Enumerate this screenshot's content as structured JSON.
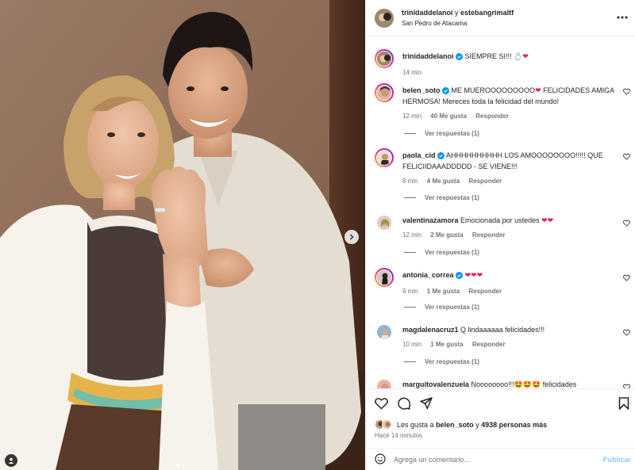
{
  "post": {
    "header": {
      "user1": "trinidaddelanoi",
      "conjunction": "y",
      "user2": "estebangrimaltf",
      "location": "San Pedro de Atacama",
      "more_icon": "more-horizontal-icon"
    },
    "caption": {
      "user": "trinidaddelanoi",
      "text": "SIEMPRE SI!!! 💍",
      "time": "14 min"
    },
    "comments": [
      {
        "user": "belen_soto",
        "verified": true,
        "text": "ME MUEROOOOOOOOO",
        "text_after": " FELICIDADES AMIGA HERMOSA! Mereces toda la felicidad del mundo!",
        "hearts": "❤",
        "time": "12 min",
        "likes": "40 Me gusta",
        "reply": "Responder",
        "view_replies": "Ver respuestas (1)"
      },
      {
        "user": "paola_cid",
        "verified": true,
        "text": "AHHHHHHHHHH LOS AMOOOOOOOO!!!!! QUE FELICIIDAAADDDDD - SE VIENE!!!",
        "text_after": "",
        "hearts": "",
        "time": "8 min",
        "likes": "4 Me gusta",
        "reply": "Responder",
        "view_replies": "Ver respuestas (1)"
      },
      {
        "user": "valentinazamora",
        "verified": false,
        "text": "Emocionada por ustedes",
        "text_after": "",
        "hearts": "❤❤",
        "time": "12 min",
        "likes": "2 Me gusta",
        "reply": "Responder",
        "view_replies": "Ver respuestas (1)"
      },
      {
        "user": "antonia_correa",
        "verified": true,
        "text": "",
        "text_after": "",
        "hearts": "❤❤❤",
        "time": "9 min",
        "likes": "1 Me gusta",
        "reply": "Responder",
        "view_replies": "Ver respuestas (1)"
      },
      {
        "user": "magdalenacruz1",
        "verified": false,
        "text": "Q lindaaaaaa felicidades!!!",
        "text_after": "",
        "hearts": "",
        "time": "10 min",
        "likes": "1 Me gusta",
        "reply": "Responder",
        "view_replies": "Ver respuestas (1)"
      },
      {
        "user": "marguitovalenzuela",
        "verified": false,
        "text": "Noooooooo!!!🤩🤩🤩 felicidades",
        "text_after": "",
        "hearts": "",
        "time": "",
        "likes": "",
        "reply": "",
        "view_replies": ""
      }
    ],
    "likes": {
      "prefix": "Les gusta a",
      "user": "belen_soto",
      "middle": "y",
      "count": "4938 personas más"
    },
    "time_ago": "Hace 14 minutos",
    "comment_input": {
      "placeholder": "Agrega un comentario...",
      "post_label": "Publicar"
    },
    "carousel": {
      "slides": 2,
      "active": 1
    },
    "colors": {
      "verified": "#0095f6",
      "heart": "#e0245e",
      "post_button": "#8fc9f7",
      "muted": "#737373"
    }
  }
}
